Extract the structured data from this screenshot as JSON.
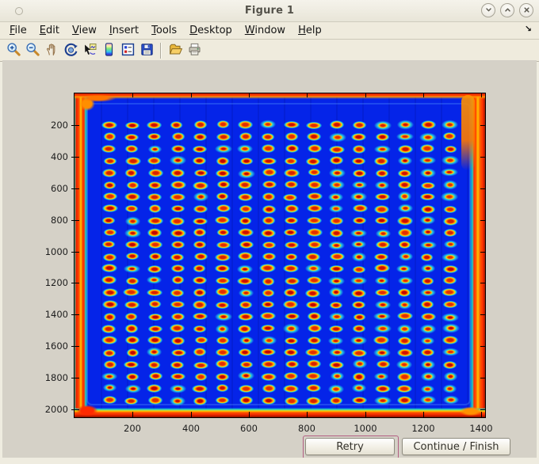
{
  "window": {
    "title": "Figure 1",
    "controls": {
      "minimize": "minimize",
      "maximize": "maximize",
      "close": "close"
    }
  },
  "menu": {
    "items": [
      {
        "label": "File"
      },
      {
        "label": "Edit"
      },
      {
        "label": "View"
      },
      {
        "label": "Insert"
      },
      {
        "label": "Tools"
      },
      {
        "label": "Desktop"
      },
      {
        "label": "Window"
      },
      {
        "label": "Help"
      }
    ],
    "overflow_arrow": "↘"
  },
  "toolbar": {
    "buttons": [
      {
        "icon": "zoom-in"
      },
      {
        "icon": "zoom-out"
      },
      {
        "icon": "pan"
      },
      {
        "icon": "rotate-3d"
      },
      {
        "icon": "data-cursor"
      },
      {
        "icon": "colorbar"
      },
      {
        "icon": "legend"
      },
      {
        "icon": "save"
      },
      {
        "icon": "separator"
      },
      {
        "icon": "open"
      },
      {
        "icon": "print"
      }
    ]
  },
  "actions": {
    "retry": "Retry",
    "continue": "Continue / Finish"
  },
  "chart_data": {
    "type": "heatmap",
    "title": "",
    "xlabel": "",
    "ylabel": "",
    "xlim": [
      0,
      1413
    ],
    "ylim": [
      0,
      2050
    ],
    "xticks": [
      200,
      400,
      600,
      800,
      1000,
      1200,
      1400
    ],
    "yticks": [
      200,
      400,
      600,
      800,
      1000,
      1200,
      1400,
      1600,
      1800,
      2000
    ],
    "colormap": "jet",
    "content": "scanned microarray / 384-well plate image: grid of hot (red-yellow) spots with cyan halos on a blue background, plate edges saturated red-orange",
    "spot_grid": {
      "rows": 24,
      "cols": 16,
      "x_start": 120,
      "x_step": 78.2,
      "y_start": 200,
      "y_step": 75.8
    },
    "colors": {
      "background": "#0524e8",
      "spot_core": "#d81800",
      "spot_ring_orange": "#ff6a00",
      "spot_ring_yellow": "#ffd400",
      "spot_halo": "#22d8e2",
      "plate_edge": "#ff3a00",
      "figure_background": "#d5d1c7",
      "chrome_background": "#efebdd",
      "focus_ring": "#b25f83"
    }
  }
}
